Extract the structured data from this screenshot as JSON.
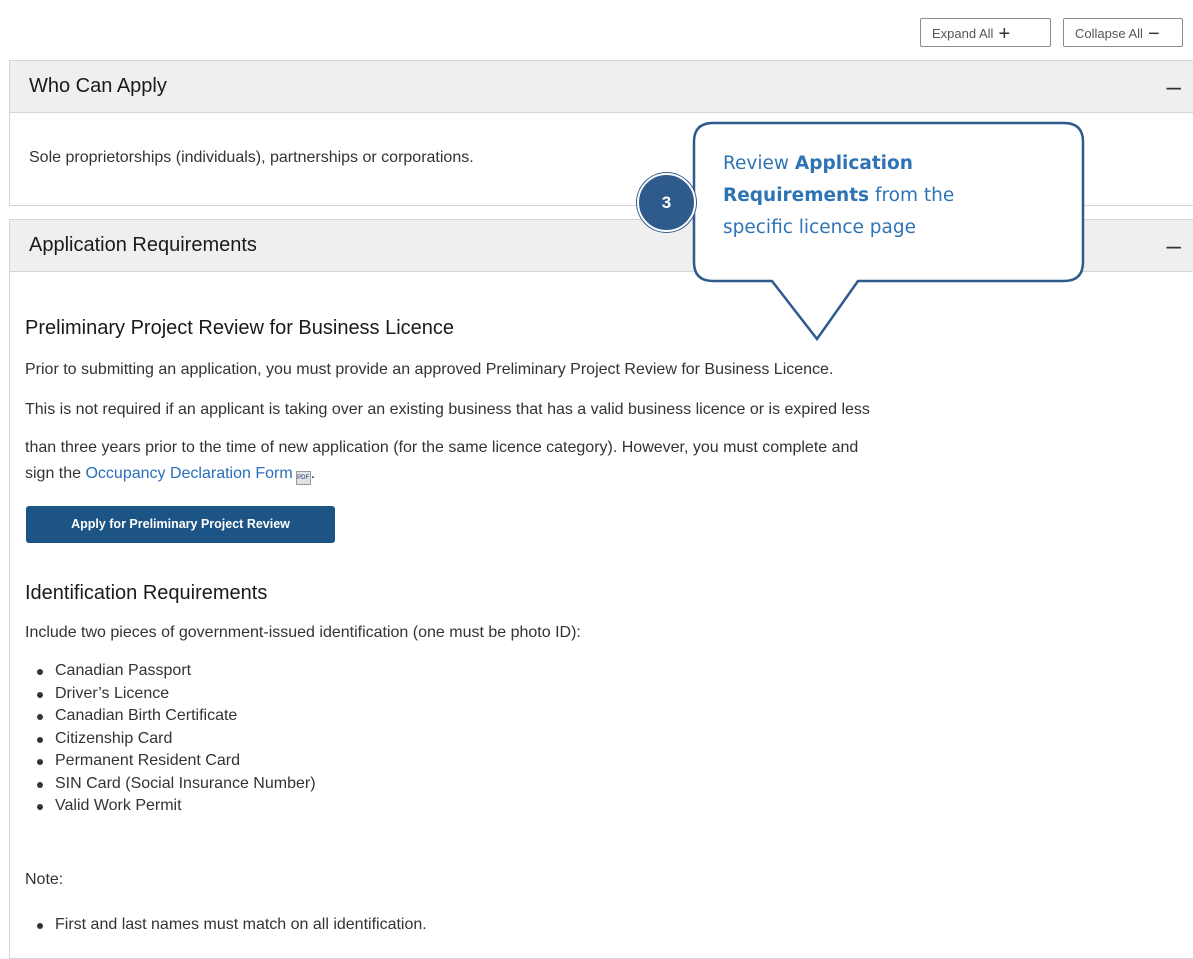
{
  "toolbar": {
    "expand_label": "Expand All",
    "expand_symbol": "+",
    "collapse_label": "Collapse All",
    "collapse_symbol": "−"
  },
  "who_can_apply": {
    "title": "Who Can Apply",
    "toggle": "–",
    "text": "Sole proprietorships (individuals), partnerships or corporations."
  },
  "application_requirements": {
    "title": "Application Requirements",
    "toggle": "–",
    "preliminary_heading": "Preliminary Project Review for Business Licence",
    "preliminary_text": "Prior to submitting an application, you must provide an approved Preliminary Project Review for Business Licence.",
    "exception_line1": "This is not required if an applicant is taking over an existing business that has a valid business licence or is expired less",
    "exception_line2": "than three years prior to the time of new application (for the same licence category). However, you must complete and",
    "exception_prefix": "sign the ",
    "form_link": "Occupancy Declaration Form",
    "pdf_icon_label": "PDF",
    "exception_suffix": ".",
    "apply_button": "Apply for Preliminary Project Review",
    "id_heading": "Identification Requirements",
    "id_intro": "Include two pieces of government-issued identification (one must be photo ID):",
    "id_items": [
      "Canadian Passport",
      "Driver’s Licence",
      "Canadian Birth Certificate",
      "Citizenship Card",
      "Permanent Resident Card",
      "SIN Card (Social Insurance Number)",
      "Valid Work Permit"
    ],
    "note_label": "Note:",
    "note_items": [
      "First and last names must match on all identification."
    ]
  },
  "callout": {
    "step_number": "3",
    "line1_prefix": "Review ",
    "line1_bold": "Application",
    "line2_bold": "Requirements",
    "line2_suffix": " from the",
    "line3": "specific licence page"
  },
  "colors": {
    "accent": "#2e74b5",
    "badge": "#2e5b8c",
    "button": "#1b5485",
    "link": "#2a6ebb",
    "header_bg": "#efefef"
  }
}
